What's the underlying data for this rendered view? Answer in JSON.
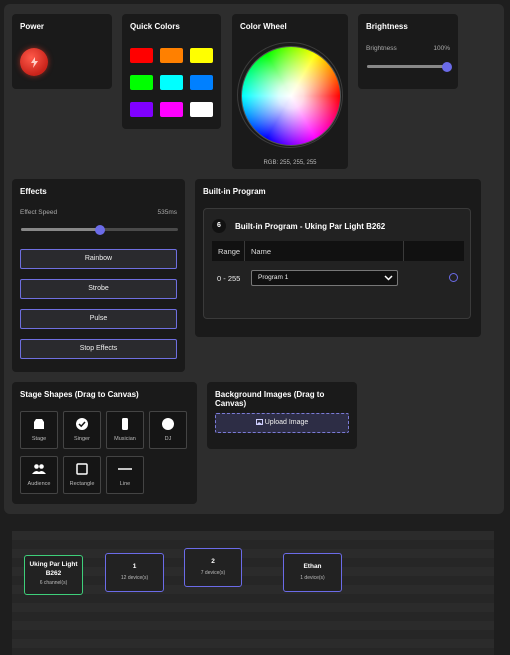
{
  "power": {
    "title": "Power",
    "icon": "lightning-icon"
  },
  "quick_colors": {
    "title": "Quick Colors",
    "swatches": [
      "#ff0000",
      "#ff8000",
      "#ffff00",
      "#00ff00",
      "#00ffff",
      "#0080ff",
      "#8000ff",
      "#ff00ff",
      "#ffffff"
    ]
  },
  "color_wheel": {
    "title": "Color Wheel",
    "rgb_text": "RGB: 255, 255, 255"
  },
  "brightness": {
    "title": "Brightness",
    "label": "Brightness",
    "value_text": "100%",
    "value": 1.0
  },
  "effects": {
    "title": "Effects",
    "speed_label": "Effect Speed",
    "speed_text": "535ms",
    "speed_fraction": 0.5,
    "buttons": [
      "Rainbow",
      "Strobe",
      "Pulse",
      "Stop Effects"
    ]
  },
  "builtin": {
    "title": "Built-in Program",
    "badge": "6",
    "header": "Built-in Program - Uking Par Light B262",
    "columns": [
      "Range",
      "Name"
    ],
    "row": {
      "range": "0 - 255",
      "selected": "Program 1"
    }
  },
  "shapes": {
    "title": "Stage Shapes (Drag to Canvas)",
    "items": [
      "Stage",
      "Singer",
      "Musician",
      "DJ",
      "Audience",
      "Rectangle",
      "Line"
    ]
  },
  "background": {
    "title": "Background Images (Drag to Canvas)",
    "upload_label": "Upload Image"
  },
  "canvas_nodes": [
    {
      "title": "Uking Par Light B262",
      "sub": "6 channel(s)",
      "selected": true
    },
    {
      "title": "1",
      "sub": "12 device(s)",
      "selected": false
    },
    {
      "title": "2",
      "sub": "7 device(s)",
      "selected": false
    },
    {
      "title": "Ethan",
      "sub": "1 device(s)",
      "selected": false
    }
  ],
  "colors": {
    "accent": "#6b6be8",
    "selected_node_border": "#3ecf7a",
    "power": "#e0322a"
  }
}
